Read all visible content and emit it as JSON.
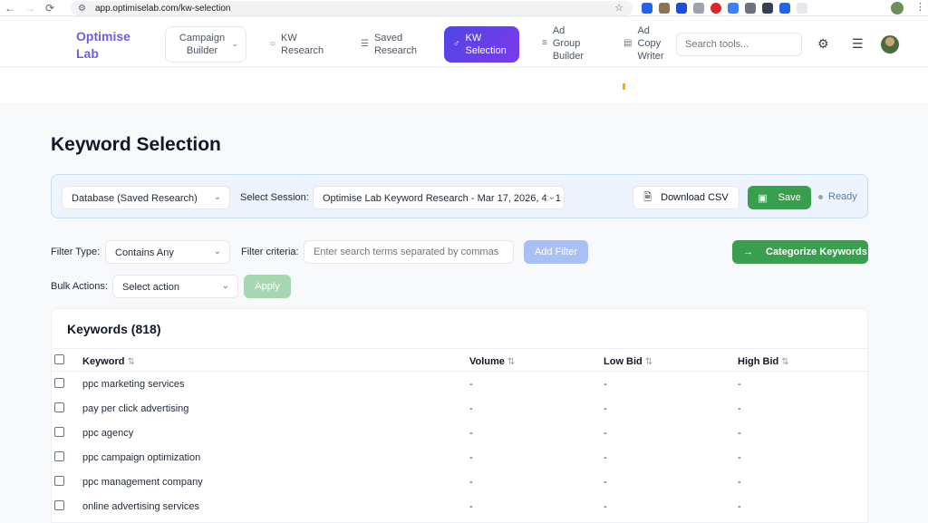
{
  "browser": {
    "url": "app.optimiselab.com/kw-selection"
  },
  "header": {
    "logo": "Optimise Lab",
    "nav": {
      "campaign_builder": "Campaign Builder",
      "kw_research": "KW Research",
      "saved_research": "Saved Research",
      "kw_selection": "KW Selection",
      "ad_group_builder": "Ad Group Builder",
      "ad_copy_writer": "Ad Copy Writer"
    },
    "search_placeholder": "Search tools..."
  },
  "page": {
    "title": "Keyword Selection"
  },
  "toolbar": {
    "database_value": "Database (Saved Research)",
    "session_label": "Select Session:",
    "session_value": "Optimise Lab Keyword Research - Mar 17, 2026, 4:31",
    "download_label": "Download CSV",
    "save_label": "Save",
    "status": "Ready"
  },
  "filters": {
    "type_label": "Filter Type:",
    "type_value": "Contains Any",
    "criteria_label": "Filter criteria:",
    "criteria_placeholder": "Enter search terms separated by commas",
    "add_filter_label": "Add Filter",
    "categorize_label": "Categorize Keywords",
    "bulk_label": "Bulk Actions:",
    "bulk_value": "Select action",
    "apply_label": "Apply"
  },
  "table": {
    "title": "Keywords (818)",
    "columns": [
      "Keyword",
      "Volume",
      "Low Bid",
      "High Bid"
    ],
    "rows": [
      {
        "keyword": "ppc marketing services",
        "volume": "-",
        "low_bid": "-",
        "high_bid": "-"
      },
      {
        "keyword": "pay per click advertising",
        "volume": "-",
        "low_bid": "-",
        "high_bid": "-"
      },
      {
        "keyword": "ppc agency",
        "volume": "-",
        "low_bid": "-",
        "high_bid": "-"
      },
      {
        "keyword": "ppc campaign optimization",
        "volume": "-",
        "low_bid": "-",
        "high_bid": "-"
      },
      {
        "keyword": "ppc management company",
        "volume": "-",
        "low_bid": "-",
        "high_bid": "-"
      },
      {
        "keyword": "online advertising services",
        "volume": "-",
        "low_bid": "-",
        "high_bid": "-"
      }
    ]
  },
  "colors": {
    "brand": "#6d5fd8",
    "active_nav": "#4f46e5",
    "green": "#3a9e4f",
    "add_filter": "#a9c0f5"
  }
}
